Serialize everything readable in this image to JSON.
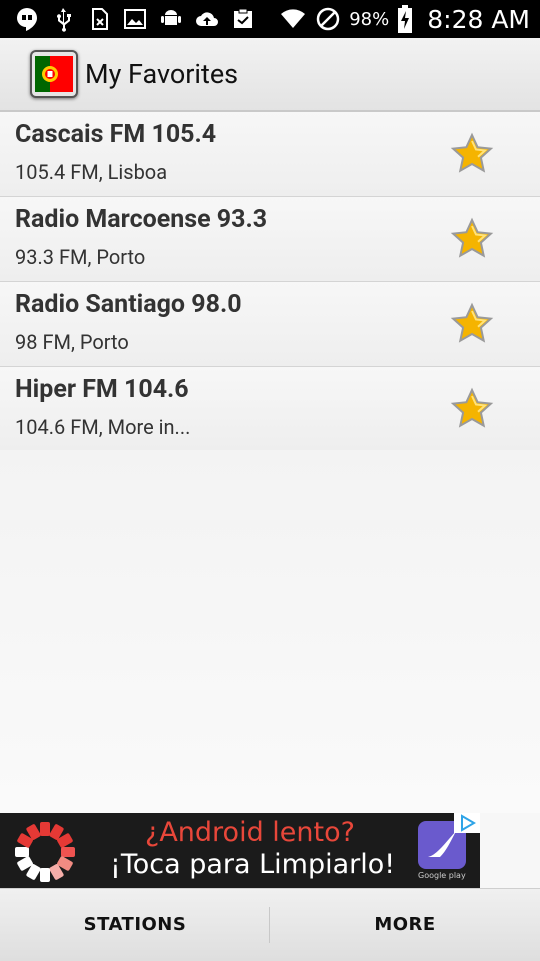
{
  "status_bar": {
    "battery_percent": "98%",
    "time": "8:28 AM",
    "left_icons": [
      "hangouts-icon",
      "usb-icon",
      "sim-icon",
      "image-icon",
      "android-icon",
      "upload-icon",
      "clipboard-icon"
    ],
    "right_icons": [
      "wifi-icon",
      "do-not-disturb-icon",
      "battery-charging-icon"
    ]
  },
  "action_bar": {
    "title": "My Favorites",
    "app_icon": "portugal-flag-icon"
  },
  "favorites": [
    {
      "name": "Cascais FM 105.4",
      "subtitle": "105.4 FM, Lisboa"
    },
    {
      "name": "Radio Marcoense 93.3",
      "subtitle": "93.3 FM, Porto"
    },
    {
      "name": "Radio Santiago 98.0",
      "subtitle": "98 FM, Porto"
    },
    {
      "name": "Hiper FM 104.6",
      "subtitle": "104.6 FM, More in..."
    }
  ],
  "ad": {
    "line1": "¿Android lento?",
    "line2": "¡Toca para Limpiarlo!",
    "store_badge": "Google play"
  },
  "bottom_tabs": {
    "stations": "STATIONS",
    "more": "MORE"
  },
  "colors": {
    "star": "#f5b400",
    "ad_accent": "#e8473a",
    "flag_green": "#006600",
    "flag_red": "#ff0000"
  }
}
